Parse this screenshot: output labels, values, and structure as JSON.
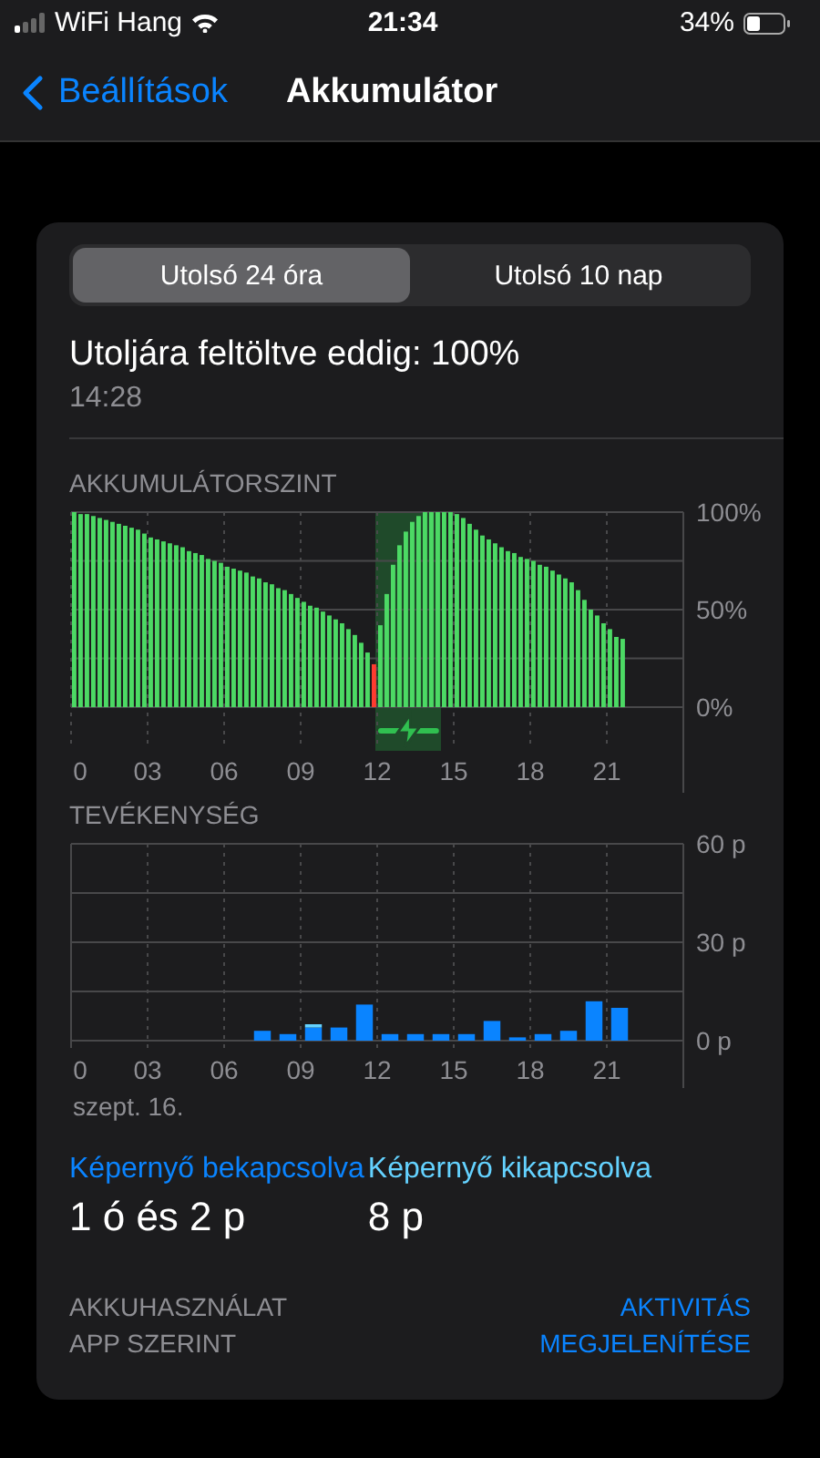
{
  "status_bar": {
    "carrier": "WiFi Hang",
    "time": "21:34",
    "battery": "34%"
  },
  "nav": {
    "back": "Beállítások",
    "title": "Akkumulátor"
  },
  "segments": [
    {
      "label": "Utolsó 24 óra",
      "selected": true
    },
    {
      "label": "Utolsó 10 nap",
      "selected": false
    }
  ],
  "last_charged": {
    "text": "Utoljára feltöltve eddig: 100%",
    "time": "14:28"
  },
  "battery_level": {
    "title": "AKKUMULÁTORSZINT",
    "chart_data": {
      "type": "bar",
      "xlim": [
        0,
        24
      ],
      "ylim": [
        0,
        100
      ],
      "x": [
        0,
        0.25,
        0.5,
        0.75,
        1,
        1.25,
        1.5,
        1.75,
        2,
        2.25,
        2.5,
        2.75,
        3,
        3.25,
        3.5,
        3.75,
        4,
        4.25,
        4.5,
        4.75,
        5,
        5.25,
        5.5,
        5.75,
        6,
        6.25,
        6.5,
        6.75,
        7,
        7.25,
        7.5,
        7.75,
        8,
        8.25,
        8.5,
        8.75,
        9,
        9.25,
        9.5,
        9.75,
        10,
        10.25,
        10.5,
        10.75,
        11,
        11.25,
        11.5,
        11.75,
        12,
        12.25,
        12.5,
        12.75,
        13,
        13.25,
        13.5,
        13.75,
        14,
        14.25,
        14.5,
        14.75,
        15,
        15.25,
        15.5,
        15.75,
        16,
        16.25,
        16.5,
        16.75,
        17,
        17.25,
        17.5,
        17.75,
        18,
        18.25,
        18.5,
        18.75,
        19,
        19.25,
        19.5,
        19.75,
        20,
        20.25,
        20.5,
        20.75,
        21,
        21.25,
        21.5
      ],
      "series": [
        {
          "color": "#4cd964",
          "values": [
            100,
            99,
            99,
            98,
            97,
            96,
            95,
            94,
            93,
            92,
            91,
            89,
            87,
            86,
            85,
            84,
            83,
            82,
            80,
            79,
            78,
            76,
            75,
            74,
            72,
            71,
            70,
            69,
            67,
            66,
            64,
            63,
            61,
            60,
            58,
            56,
            54,
            52,
            51,
            49,
            47,
            45,
            43,
            40,
            37,
            33,
            28,
            null,
            42,
            58,
            73,
            83,
            90,
            95,
            98,
            100,
            100,
            100,
            100,
            100,
            99,
            97,
            94,
            91,
            88,
            86,
            84,
            82,
            80,
            79,
            77,
            76,
            75,
            73,
            72,
            70,
            68,
            66,
            64,
            60,
            55,
            50,
            47,
            43,
            40,
            36,
            35
          ]
        },
        {
          "color": "#ff3b30",
          "values": [
            null,
            null,
            null,
            null,
            null,
            null,
            null,
            null,
            null,
            null,
            null,
            null,
            null,
            null,
            null,
            null,
            null,
            null,
            null,
            null,
            null,
            null,
            null,
            null,
            null,
            null,
            null,
            null,
            null,
            null,
            null,
            null,
            null,
            null,
            null,
            null,
            null,
            null,
            null,
            null,
            null,
            null,
            null,
            null,
            null,
            null,
            null,
            22,
            null,
            null,
            null,
            null,
            null,
            null,
            null,
            null,
            null,
            null,
            null,
            null,
            null,
            null,
            null,
            null,
            null,
            null,
            null,
            null,
            null,
            null,
            null,
            null,
            null,
            null,
            null,
            null,
            null,
            null,
            null,
            null,
            null,
            null,
            null,
            null,
            null,
            null,
            null
          ]
        }
      ],
      "xticks": [
        {
          "value": 0,
          "label": "0"
        },
        {
          "value": 3,
          "label": "03"
        },
        {
          "value": 6,
          "label": "06"
        },
        {
          "value": 9,
          "label": "09"
        },
        {
          "value": 12,
          "label": "12"
        },
        {
          "value": 15,
          "label": "15"
        },
        {
          "value": 18,
          "label": "18"
        },
        {
          "value": 21,
          "label": "21"
        }
      ],
      "yticks": [
        {
          "value": 0,
          "label": "0%"
        },
        {
          "value": 50,
          "label": "50%"
        },
        {
          "value": 100,
          "label": "100%"
        }
      ],
      "grid": true
    }
  },
  "activity": {
    "title": "TEVÉKENYSÉG",
    "date": "szept. 16.",
    "chart_data": {
      "type": "bar",
      "stacked": true,
      "xlim": [
        0,
        24
      ],
      "ylim": [
        0,
        60
      ],
      "x": [
        7.5,
        8.5,
        9.5,
        10.5,
        11.5,
        12.5,
        13.5,
        14.5,
        15.5,
        16.5,
        17.5,
        18.5,
        19.5,
        20.5,
        21.5
      ],
      "series": [
        {
          "name": "Képernyő bekapcsolva",
          "color": "#0a84ff",
          "values": [
            3,
            2,
            4,
            4,
            11,
            2,
            2,
            2,
            2,
            6,
            1,
            2,
            3,
            12,
            10
          ]
        },
        {
          "name": "Képernyő kikapcsolva",
          "color": "#64d2ff",
          "values": [
            0,
            0,
            1,
            0,
            0,
            0,
            0,
            0,
            0,
            0,
            0,
            0,
            0,
            0,
            0
          ]
        }
      ],
      "xticks": [
        {
          "value": 0,
          "label": "0"
        },
        {
          "value": 3,
          "label": "03"
        },
        {
          "value": 6,
          "label": "06"
        },
        {
          "value": 9,
          "label": "09"
        },
        {
          "value": 12,
          "label": "12"
        },
        {
          "value": 15,
          "label": "15"
        },
        {
          "value": 18,
          "label": "18"
        },
        {
          "value": 21,
          "label": "21"
        }
      ],
      "yticks": [
        {
          "value": 0,
          "label": "0 p"
        },
        {
          "value": 30,
          "label": "30 p"
        },
        {
          "value": 60,
          "label": "60 p"
        }
      ],
      "grid": true
    }
  },
  "screen": [
    {
      "value": "1 ó és 2 p"
    },
    {
      "value": "8 p"
    }
  ],
  "usage": {
    "label": "AKKUHASZNÁLAT\nAPP SZERINT",
    "link": "AKTIVITÁS\nMEGJELENÍTÉSE"
  }
}
